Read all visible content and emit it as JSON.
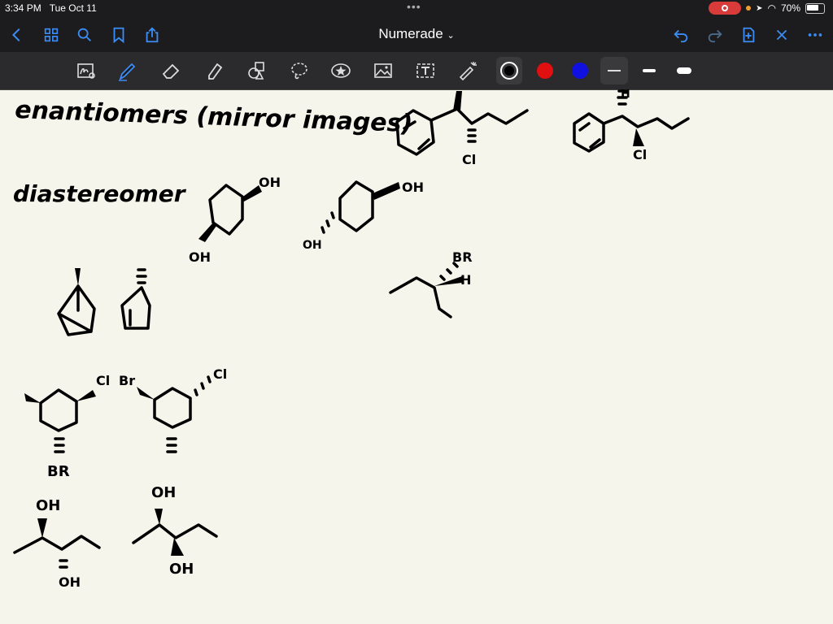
{
  "status_bar": {
    "time": "3:34 PM",
    "date": "Tue Oct 11",
    "battery": "70%"
  },
  "nav": {
    "title": "Numerade"
  },
  "toolbar": {
    "colors": {
      "black": "#000000",
      "red": "#e01010",
      "blue": "#1010e0"
    }
  },
  "canvas": {
    "headings": {
      "enantiomers": "enantiomers (mirror images)",
      "diastereomer": "diastereomer"
    },
    "labels": {
      "oh": "OH",
      "cl": "Cl",
      "br": "Br",
      "h": "H",
      "oh_upper": "OH",
      "cl_upper": "Cl",
      "br_upper": "BR"
    }
  }
}
